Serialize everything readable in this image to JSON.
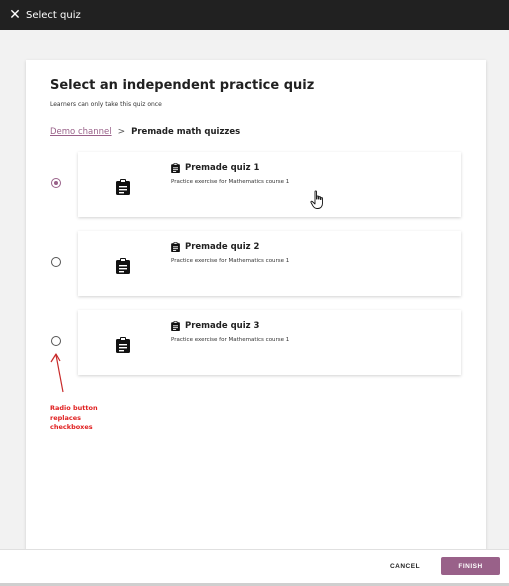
{
  "window": {
    "title": "Select quiz",
    "close_icon": "close-icon"
  },
  "main": {
    "heading": "Select an independent practice quiz",
    "subtext": "Learners can only take this quiz once",
    "breadcrumb": {
      "parent": "Demo channel",
      "separator": ">",
      "current": "Premade math quizzes"
    },
    "quizzes": [
      {
        "title": "Premade quiz 1",
        "description": "Practice exercise for Mathematics course 1",
        "selected": true
      },
      {
        "title": "Premade quiz 2",
        "description": "Practice exercise for Mathematics course 1",
        "selected": false
      },
      {
        "title": "Premade quiz 3",
        "description": "Practice exercise for Mathematics course 1",
        "selected": false
      }
    ]
  },
  "annotation": {
    "text": "Radio button replaces checkboxes",
    "color": "#e02020"
  },
  "footer": {
    "cancel_label": "CANCEL",
    "finish_label": "FINISH"
  },
  "colors": {
    "topbar": "#212121",
    "accent": "#996189"
  }
}
